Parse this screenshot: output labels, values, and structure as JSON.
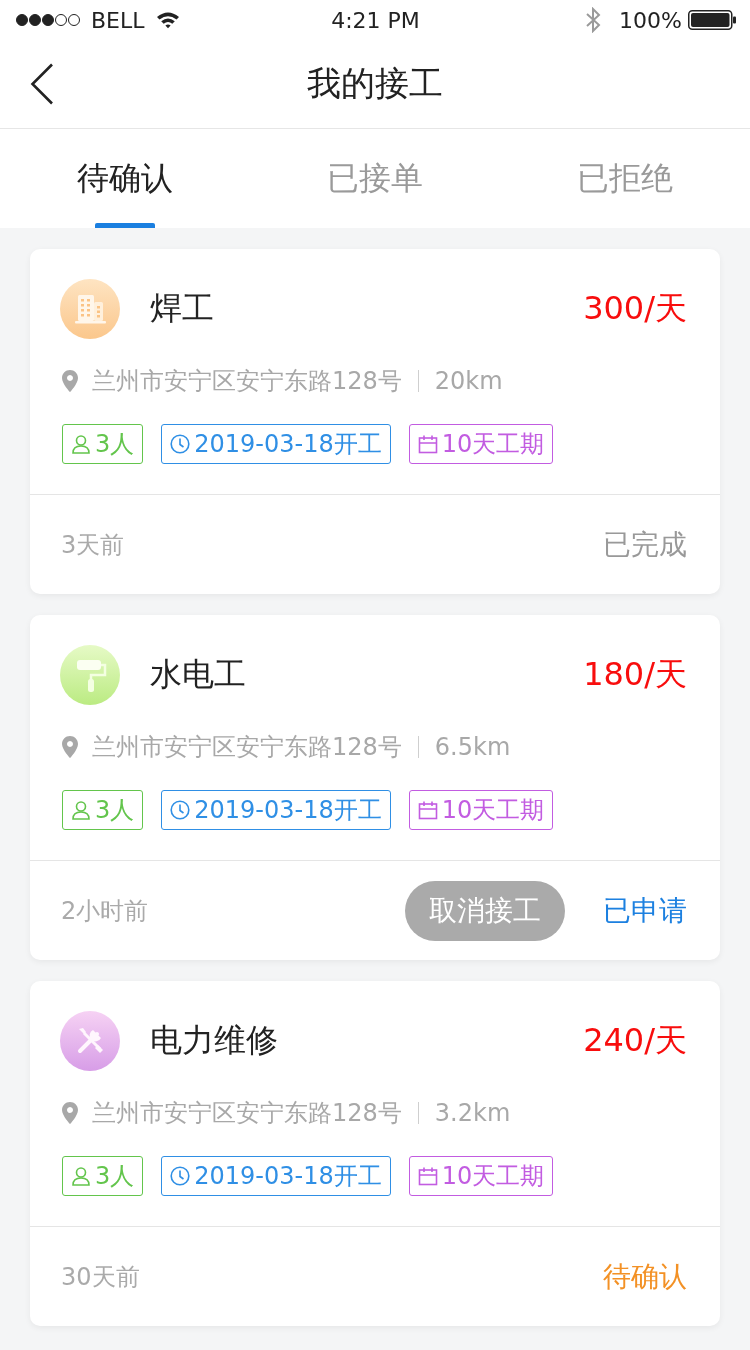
{
  "status_bar": {
    "carrier": "BELL",
    "time": "4:21 PM",
    "battery": "100%"
  },
  "nav": {
    "title": "我的接工"
  },
  "tabs": [
    {
      "label": "待确认",
      "selected": true
    },
    {
      "label": "已接单",
      "selected": false
    },
    {
      "label": "已拒绝",
      "selected": false
    }
  ],
  "jobs": [
    {
      "kind": "building",
      "title": "焊工",
      "price": "300/天",
      "address": "兰州市安宁区安宁东路128号",
      "distance": "20km",
      "tags": [
        {
          "kind": "people",
          "text": "3人"
        },
        {
          "kind": "start",
          "text": "2019-03-18开工"
        },
        {
          "kind": "duration",
          "text": "10天工期"
        }
      ],
      "time": "3天前",
      "status": {
        "kind": "done",
        "text": "已完成"
      }
    },
    {
      "kind": "roller",
      "title": "水电工",
      "price": "180/天",
      "address": "兰州市安宁区安宁东路128号",
      "distance": "6.5km",
      "tags": [
        {
          "kind": "people",
          "text": "3人"
        },
        {
          "kind": "start",
          "text": "2019-03-18开工"
        },
        {
          "kind": "duration",
          "text": "10天工期"
        }
      ],
      "time": "2小时前",
      "action": "取消接工",
      "status": {
        "kind": "applied",
        "text": "已申请"
      }
    },
    {
      "kind": "tools",
      "title": "电力维修",
      "price": "240/天",
      "address": "兰州市安宁区安宁东路128号",
      "distance": "3.2km",
      "tags": [
        {
          "kind": "people",
          "text": "3人"
        },
        {
          "kind": "start",
          "text": "2019-03-18开工"
        },
        {
          "kind": "duration",
          "text": "10天工期"
        }
      ],
      "time": "30天前",
      "status": {
        "kind": "pending",
        "text": "待确认"
      }
    }
  ]
}
